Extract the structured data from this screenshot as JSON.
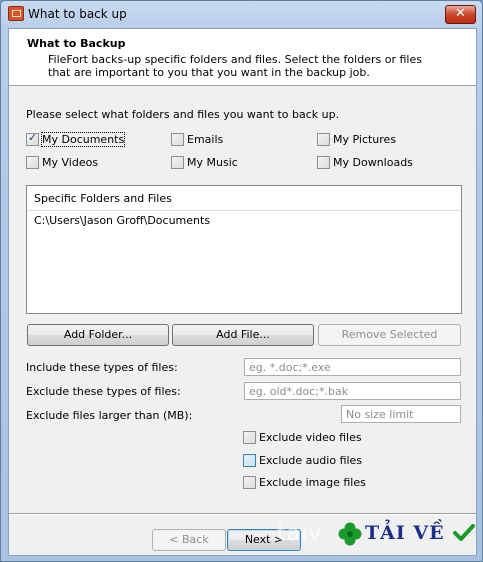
{
  "window": {
    "title": "What to back up",
    "close_glyph": "✕"
  },
  "header": {
    "title": "What to Backup",
    "description": "FileFort backs-up specific folders and files. Select the folders or files that are important to you that you want in the backup job."
  },
  "prompt": "Please select what folders and files you want to back up.",
  "checkboxes": [
    {
      "label": "My Documents",
      "checked": true
    },
    {
      "label": "Emails",
      "checked": false
    },
    {
      "label": "My Pictures",
      "checked": false
    },
    {
      "label": "My Videos",
      "checked": false
    },
    {
      "label": "My Music",
      "checked": false
    },
    {
      "label": "My Downloads",
      "checked": false
    }
  ],
  "list": {
    "header": "Specific Folders and Files",
    "rows": [
      "C:\\Users\\Jason Groff\\Documents"
    ]
  },
  "buttons": {
    "add_folder": "Add Folder...",
    "add_file": "Add File...",
    "remove_selected": "Remove Selected",
    "back": "< Back",
    "next": "Next >"
  },
  "filters": {
    "include_label": "Include these types of files:",
    "include_placeholder": "eg. *.doc;*.exe",
    "exclude_label": "Exclude these types of files:",
    "exclude_placeholder": "eg. old*.doc;*.bak",
    "size_label": "Exclude files larger than (MB):",
    "size_placeholder": "No size limit"
  },
  "exclude_options": [
    {
      "label": "Exclude video files",
      "checked": false
    },
    {
      "label": "Exclude audio files",
      "checked": false
    },
    {
      "label": "Exclude image files",
      "checked": false
    }
  ],
  "watermark": {
    "faint": "taiv",
    "brand": "TẢI VỀ"
  }
}
